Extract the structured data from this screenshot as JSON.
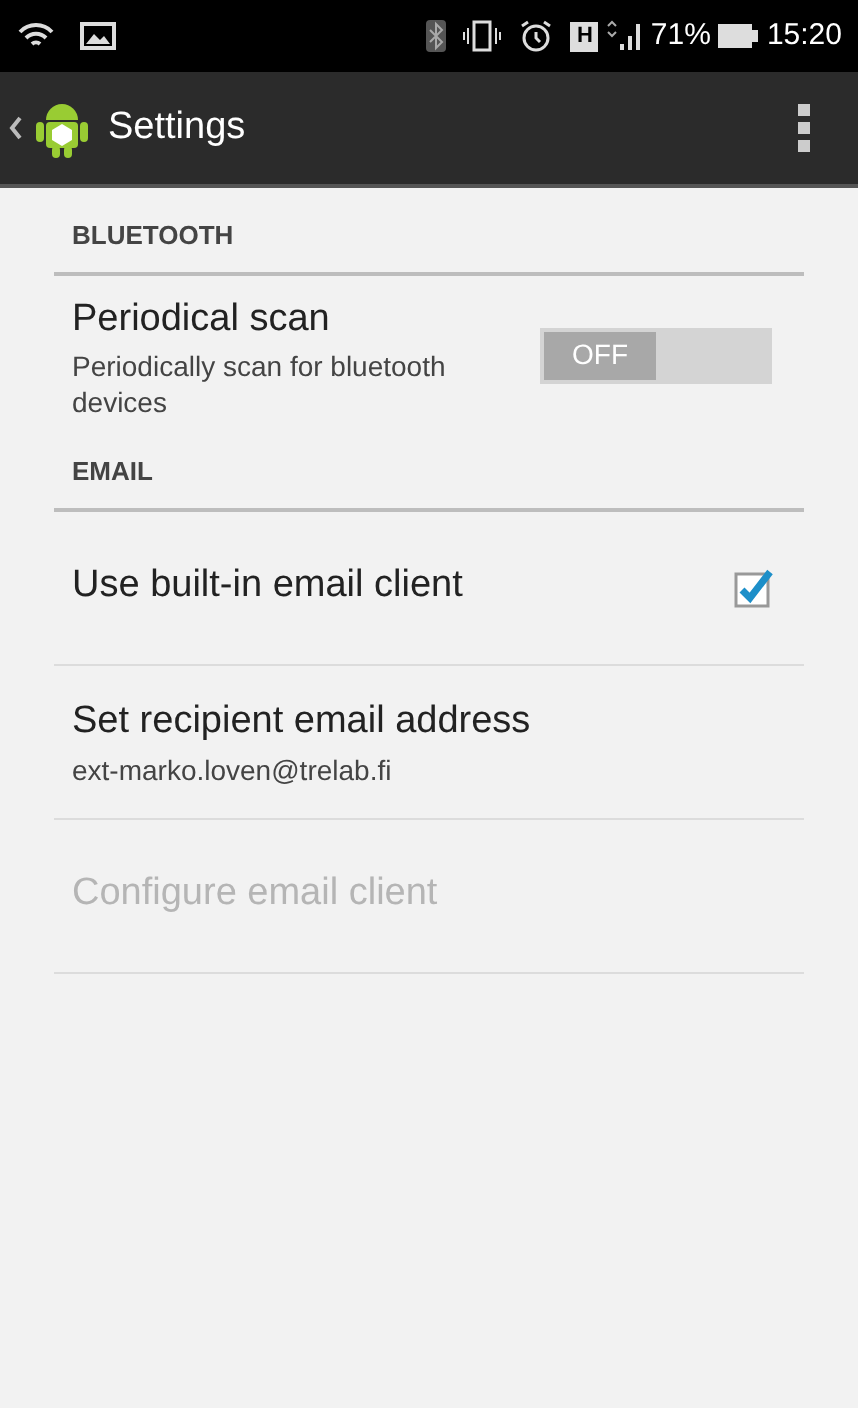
{
  "status_bar": {
    "network_type": "H",
    "battery": "71%",
    "time": "15:20"
  },
  "action_bar": {
    "title": "Settings"
  },
  "categories": [
    {
      "title": "BLUETOOTH",
      "items": [
        {
          "kind": "switch",
          "title": "Periodical scan",
          "summary": "Periodically scan for bluetooth devices",
          "on": false,
          "switch_label": "OFF",
          "disabled": false
        }
      ]
    },
    {
      "title": "EMAIL",
      "items": [
        {
          "kind": "checkbox",
          "title": "Use built-in email client",
          "checked": true,
          "disabled": false
        },
        {
          "kind": "plain",
          "title": "Set recipient email address",
          "summary": "ext-marko.loven@trelab.fi",
          "disabled": false
        },
        {
          "kind": "plain",
          "title": "Configure email client",
          "disabled": true
        }
      ]
    }
  ]
}
